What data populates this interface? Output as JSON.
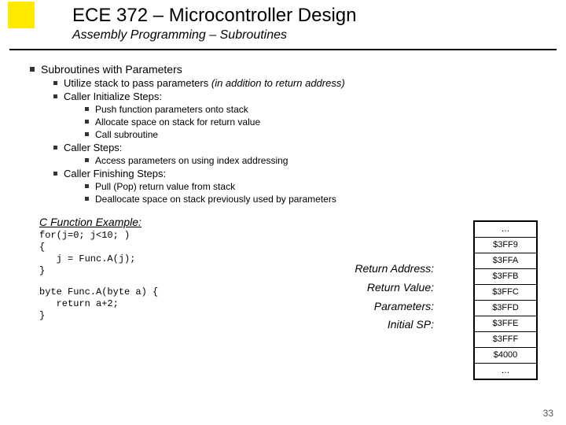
{
  "header": {
    "title": "ECE 372 – Microcontroller Design",
    "subtitle": "Assembly Programming – Subroutines"
  },
  "h1": "Subroutines with Parameters",
  "l1a_pre": "Utilize stack to pass parameters ",
  "l1a_it": "(in addition to return address)",
  "l1b": "Caller Initialize Steps:",
  "l1b1": "Push function parameters onto stack",
  "l1b2": "Allocate space on stack for return value",
  "l1b3": "Call subroutine",
  "l1c": "Caller Steps:",
  "l1c1": "Access parameters on using index addressing",
  "l1d": "Caller Finishing Steps:",
  "l1d1": "Pull (Pop) return value from stack",
  "l1d2": "Deallocate space on stack previously used by parameters",
  "example_title": "C Function Example:",
  "code1": "for(j=0; j<10; )\n{\n   j = Func.A(j);\n}",
  "code2": "byte Func.A(byte a) {\n   return a+2;\n}",
  "labels": {
    "ra": "Return Address:",
    "rv": "Return Value:",
    "pa": "Parameters:",
    "sp": "Initial SP:"
  },
  "stack": [
    "…",
    "$3FF9",
    "$3FFA",
    "$3FFB",
    "$3FFC",
    "$3FFD",
    "$3FFE",
    "$3FFF",
    "$4000",
    "…"
  ],
  "pagenum": "33"
}
